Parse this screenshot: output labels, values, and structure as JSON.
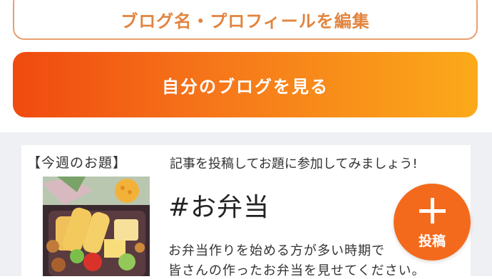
{
  "profile": {
    "edit_label": "ブログ名・プロフィールを編集",
    "view_label": "自分のブログを見る",
    "accent_gradient": [
      "#f04a10",
      "#fbaa1a"
    ]
  },
  "theme": {
    "tag": "【今週のお題】",
    "lead": "記事を投稿してお題に参加してみましょう!",
    "title": "#お弁当",
    "description_line1": "お弁当作りを始める方が多い時期で",
    "description_line2": "皆さんの作ったお弁当を見せてください。",
    "image_subject": "bento-photo"
  },
  "post_button": {
    "icon": "plus-icon",
    "label": "投稿",
    "color": "#f46a1c"
  }
}
